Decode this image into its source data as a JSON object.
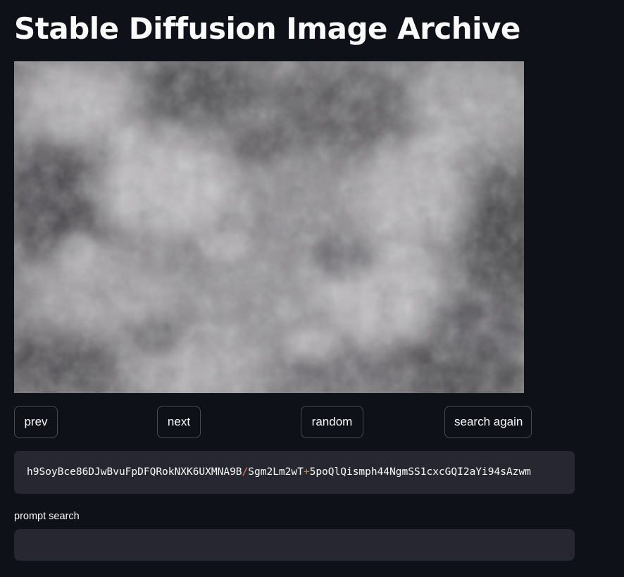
{
  "app": {
    "title": "Stable Diffusion Image Archive"
  },
  "image": {
    "alt": "generated image",
    "colors": {
      "base": "#7d7b7e",
      "light": "#c4c2c5",
      "dark": "#3e3c40"
    }
  },
  "nav": {
    "prev_label": "prev",
    "next_label": "next",
    "random_label": "random",
    "search_again_label": "search again"
  },
  "code": {
    "part1": "h9SoyBce86DJwBvuFpDFQRokNXK6UXMNA9B",
    "sep1": "/",
    "part2": "Sgm2Lm2wT",
    "sep2": "+",
    "part3": "5poQlQismph44NgmSS1cxcGQI2aYi94sAzwm"
  },
  "search": {
    "label": "prompt search",
    "value": "",
    "placeholder": ""
  },
  "colors": {
    "background": "#0e1117",
    "surface": "#262730",
    "text": "#fafafa",
    "accent": "#f0794a"
  }
}
